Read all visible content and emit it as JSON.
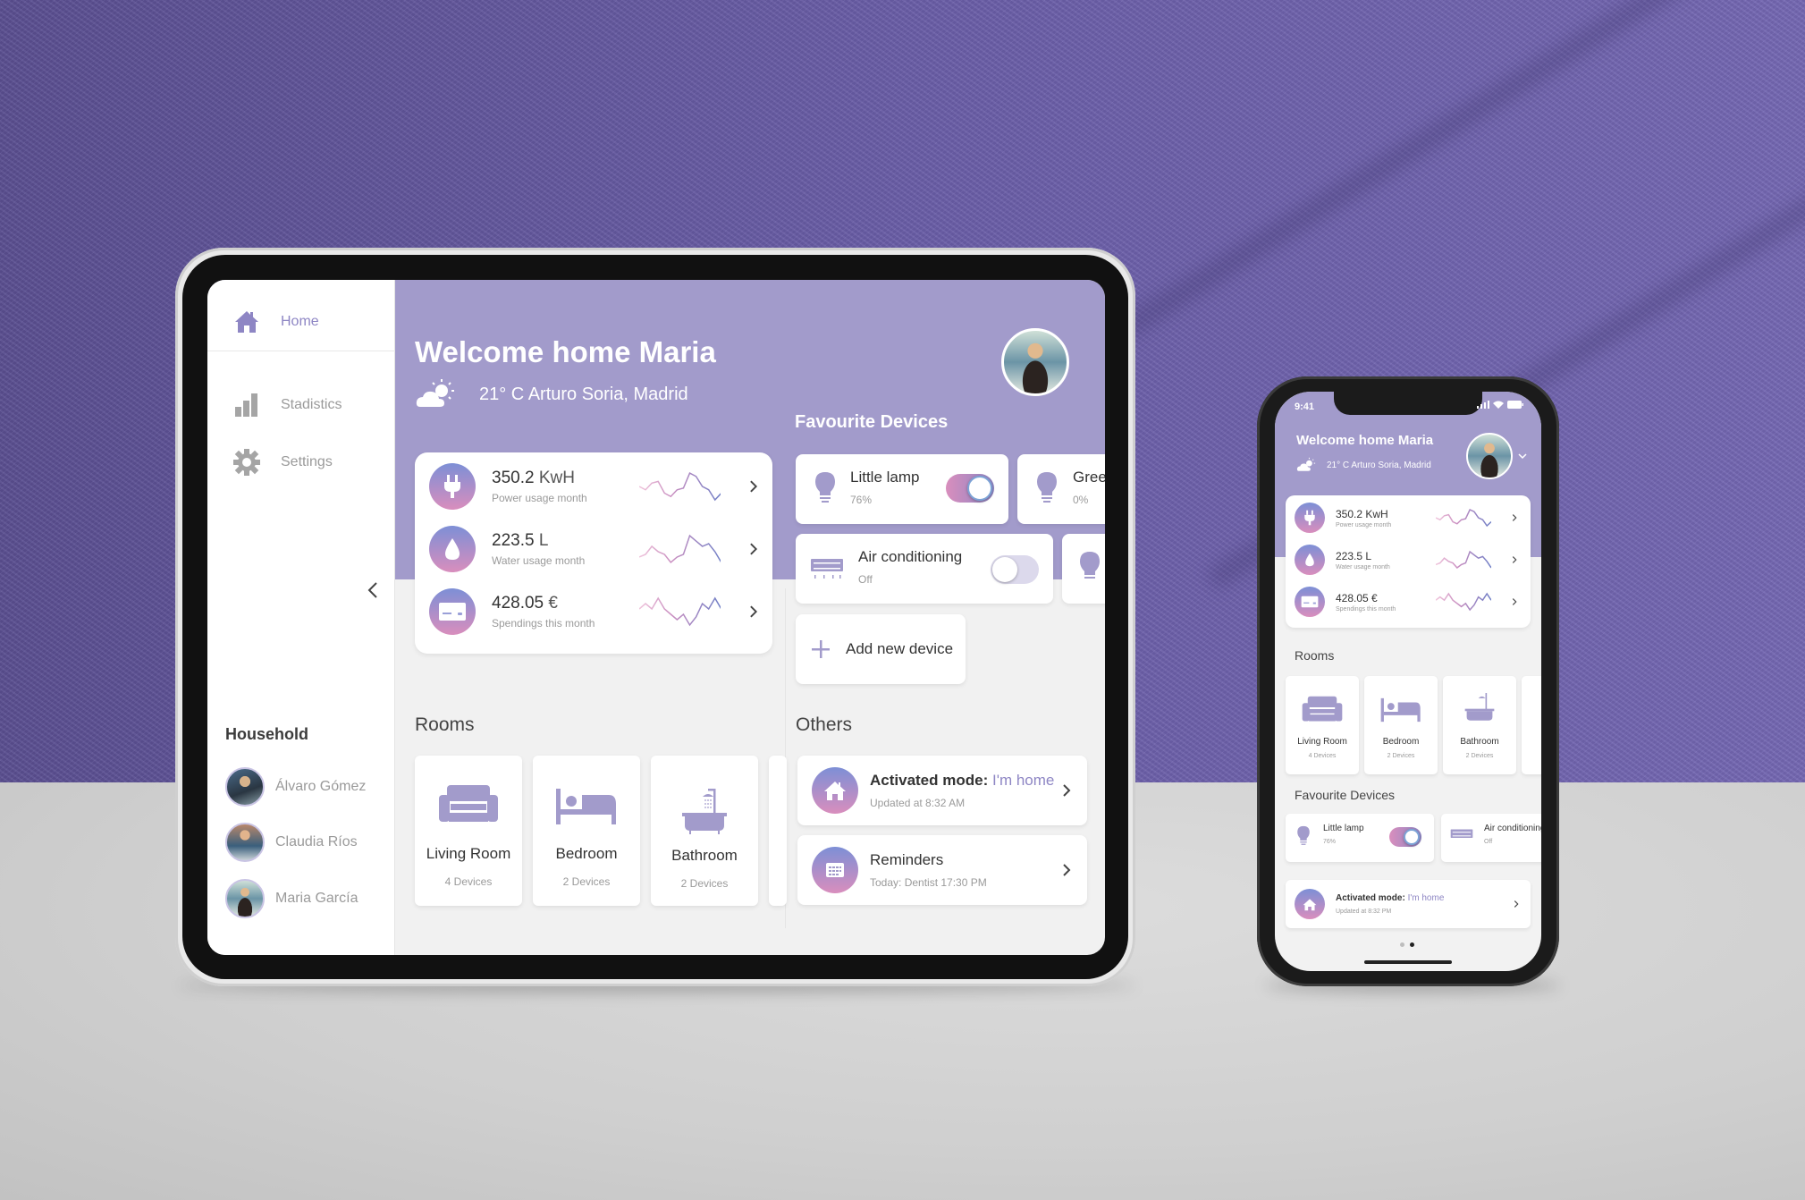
{
  "colors": {
    "accent": "#8e86c4",
    "header_bg": "#a29bcb",
    "gradient_top": "#7d8fd6",
    "gradient_bottom": "#d98ebd",
    "text_dark": "#333333",
    "text_muted": "#9a9a9a",
    "wall": "#6a5ea8",
    "floor": "#cfcfcf"
  },
  "tablet": {
    "sidebar": {
      "nav": [
        {
          "label": "Home",
          "icon": "house-icon",
          "active": true
        },
        {
          "label": "Stadistics",
          "icon": "bar-chart-icon",
          "active": false
        },
        {
          "label": "Settings",
          "icon": "gear-icon",
          "active": false
        }
      ],
      "collapse_icon": "chevron-left-icon",
      "household_title": "Household",
      "members": [
        {
          "name": "Álvaro Gómez"
        },
        {
          "name": "Claudia Ríos"
        },
        {
          "name": "Maria García"
        }
      ]
    },
    "header": {
      "welcome": "Welcome home Maria",
      "weather_icon": "partly-cloudy-icon",
      "weather_text": "21° C  Arturo Soria, Madrid"
    },
    "stats": [
      {
        "value": "350.2",
        "unit": "KwH",
        "label": "Power usage month",
        "icon": "plug-icon",
        "trend": [
          5,
          4,
          6,
          6.5,
          3,
          2,
          4,
          4.5,
          9,
          8,
          5,
          4,
          1,
          3
        ]
      },
      {
        "value": "223.5",
        "unit": "L",
        "label": "Water usage month",
        "icon": "water-drop-icon",
        "trend": [
          4,
          4.5,
          6,
          5,
          4.5,
          3,
          4,
          4.5,
          8,
          7,
          6,
          6.5,
          5,
          3
        ]
      },
      {
        "value": "428.05",
        "unit": "€",
        "label": "Spendings this month",
        "icon": "card-icon",
        "trend": [
          5,
          6,
          5,
          7,
          5,
          4,
          3,
          4,
          2,
          3.5,
          6,
          5,
          7,
          5
        ]
      }
    ],
    "favourite_devices": {
      "title": "Favourite Devices",
      "items": [
        {
          "name": "Little lamp",
          "status": "76%",
          "icon": "lightbulb-icon",
          "on": true
        },
        {
          "name": "Green",
          "status": "0%",
          "icon": "lightbulb-icon",
          "on": false
        },
        {
          "name": "Air conditioning",
          "status": "Off",
          "icon": "air-conditioner-icon",
          "on": false
        }
      ],
      "add_label": "Add new device"
    },
    "rooms": {
      "title": "Rooms",
      "items": [
        {
          "name": "Living Room",
          "devices": "4 Devices",
          "icon": "sofa-icon"
        },
        {
          "name": "Bedroom",
          "devices": "2 Devices",
          "icon": "bed-icon"
        },
        {
          "name": "Bathroom",
          "devices": "2 Devices",
          "icon": "bathtub-icon"
        }
      ]
    },
    "others": {
      "title": "Others",
      "items": [
        {
          "title_bold": "Activated mode:",
          "title_accent": " I'm home",
          "sub": "Updated  at 8:32 AM",
          "icon": "house-icon"
        },
        {
          "title_bold": "Reminders",
          "title_accent": "",
          "sub": "Today: Dentist  17:30 PM",
          "icon": "calendar-icon"
        }
      ]
    }
  },
  "phone": {
    "status_time": "9:41",
    "header": {
      "welcome": "Welcome home Maria",
      "weather_text": "21° C  Arturo Soria, Madrid"
    },
    "stats": [
      {
        "value": "350.2",
        "unit": "KwH",
        "label": "Power usage month"
      },
      {
        "value": "223.5",
        "unit": "L",
        "label": "Water usage month"
      },
      {
        "value": "428.05",
        "unit": "€",
        "label": "Spendings this month"
      }
    ],
    "rooms_title": "Rooms",
    "rooms": [
      {
        "name": "Living Room",
        "devices": "4 Devices"
      },
      {
        "name": "Bedroom",
        "devices": "2 Devices"
      },
      {
        "name": "Bathroom",
        "devices": "2 Devices"
      }
    ],
    "fav_title": "Favourite Devices",
    "devices": [
      {
        "name": "Little lamp",
        "status": "76%",
        "on": true
      },
      {
        "name": "Air conditioning",
        "status": "Off",
        "on": false
      }
    ],
    "other": {
      "title_bold": "Activated mode:",
      "title_accent": " I'm home",
      "sub": "Updated  at 8:32 PM"
    },
    "page_dots": {
      "count": 2,
      "active": 2
    }
  }
}
